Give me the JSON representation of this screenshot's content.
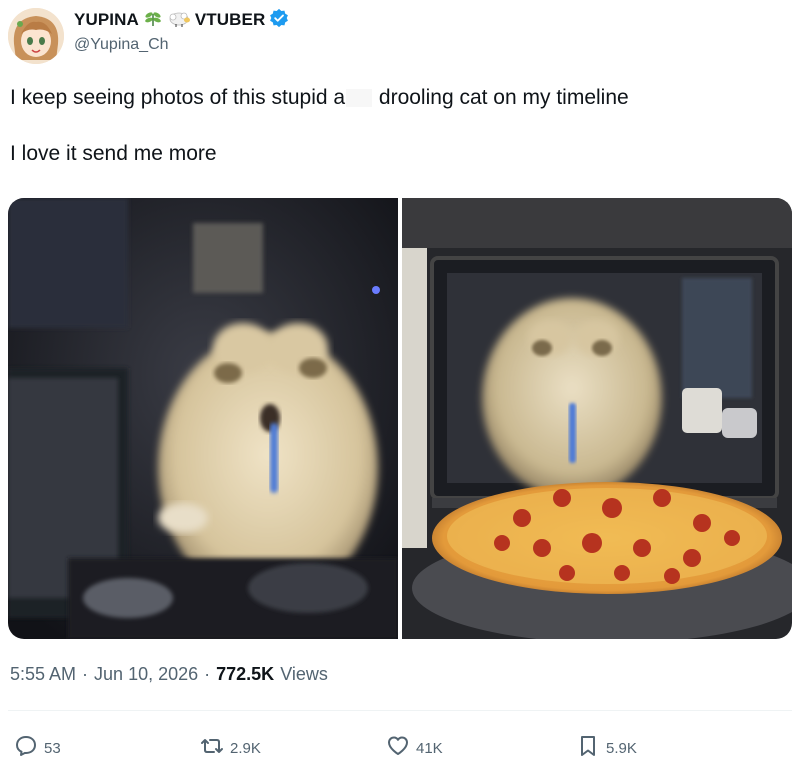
{
  "author": {
    "display_name": "YUPINA",
    "label": "VTUBER",
    "handle": "@Yupina_Ch",
    "verified": true,
    "badge_emojis": [
      "herb-emoji",
      "sheep-emoji"
    ],
    "verified_color": "#1d9bf0"
  },
  "tweet": {
    "line1_before": "I keep seeing photos of this stupid a",
    "line1_after": " drooling cat on my timeline",
    "line2": "I love it send me more"
  },
  "media": [
    {
      "description": "blurred drooling cat at a computer desk"
    },
    {
      "description": "blurred drooling cat behind microwave window with pepperoni pizza"
    }
  ],
  "meta": {
    "time": "5:55 AM",
    "separator": "·",
    "date": "Jun 10, 2026",
    "views_count": "772.5K",
    "views_label": "Views"
  },
  "actions": {
    "replies": "53",
    "reposts": "2.9K",
    "likes": "41K",
    "bookmarks": "5.9K"
  },
  "colors": {
    "text": "#0f1419",
    "secondary": "#536471",
    "divider": "#eff3f4"
  }
}
